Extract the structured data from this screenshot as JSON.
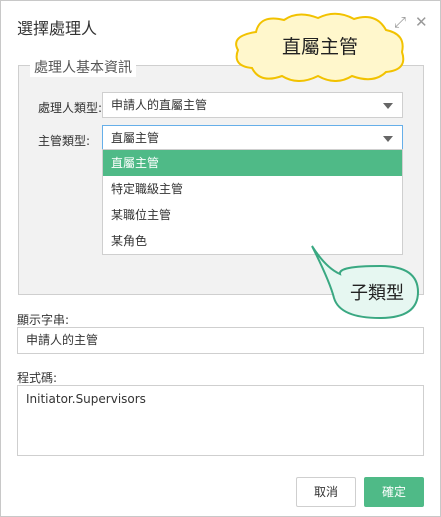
{
  "dialog": {
    "title": "選擇處理人",
    "expand_icon": "expand-icon",
    "close_icon": "close-icon"
  },
  "group": {
    "legend": "處理人基本資訊",
    "handler_type_label": "處理人類型:",
    "handler_type_value": "申請人的直屬主管",
    "manager_type_label": "主管類型:",
    "manager_type_value": "直屬主管",
    "options": [
      "直屬主管",
      "特定職級主管",
      "某職位主管",
      "某角色"
    ],
    "selected_index": 0
  },
  "display_string": {
    "label": "顯示字串:",
    "value": "申請人的主管"
  },
  "code": {
    "label": "程式碼:",
    "value": "Initiator.Supervisors"
  },
  "buttons": {
    "cancel": "取消",
    "ok": "確定"
  },
  "callouts": {
    "top": "直屬主管",
    "bottom": "子類型"
  },
  "colors": {
    "accent": "#4fba87",
    "callout_fill": "#fff7cc",
    "callout_stroke": "#f2c200",
    "callout2_fill": "#e6f7f1",
    "callout2_stroke": "#3aa882"
  }
}
